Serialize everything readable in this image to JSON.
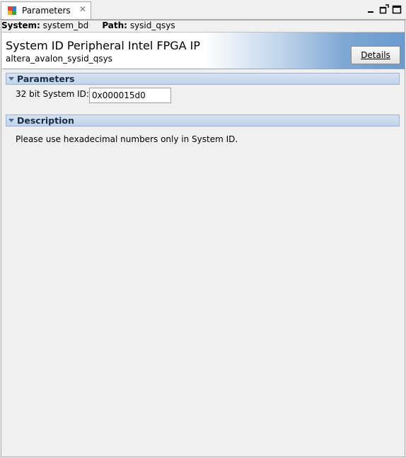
{
  "tab": {
    "label": "Parameters",
    "icon": "parameters-icon",
    "close_icon": "close-icon"
  },
  "window_controls": [
    "minimize-icon",
    "detach-icon",
    "maximize-icon"
  ],
  "pathbar": {
    "system_label": "System:",
    "system_value": "system_bd",
    "path_label": "Path:",
    "path_value": "sysid_qsys"
  },
  "header": {
    "title": "System ID Peripheral Intel FPGA IP",
    "subtitle": "altera_avalon_sysid_qsys",
    "details_label": "Details"
  },
  "parameters": {
    "section_label": "Parameters",
    "field_label": "32 bit System ID:",
    "field_value": "0x000015d0"
  },
  "description": {
    "section_label": "Description",
    "text": "Please use hexadecimal numbers only in System ID."
  },
  "colors": {
    "section_bar": "#c1d4ea",
    "header_gradient_end": "#6b9bcf",
    "background": "#f0f0f0"
  }
}
